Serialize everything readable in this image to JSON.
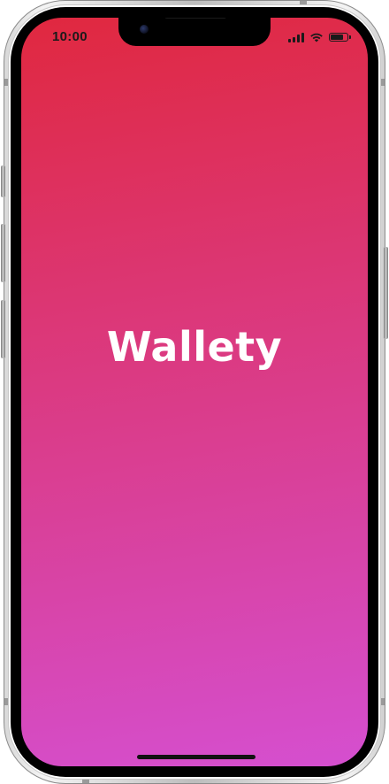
{
  "status_bar": {
    "time": "10:00",
    "signal_bars": 4,
    "battery_level": 0.85,
    "icons": [
      "cellular-signal-icon",
      "wifi-icon",
      "battery-icon"
    ]
  },
  "splash": {
    "app_name": "Wallety"
  },
  "colors": {
    "gradient_top": "#e0283f",
    "gradient_bottom": "#d54fd0",
    "text": "#ffffff",
    "status_text": "#1a1a1a"
  }
}
